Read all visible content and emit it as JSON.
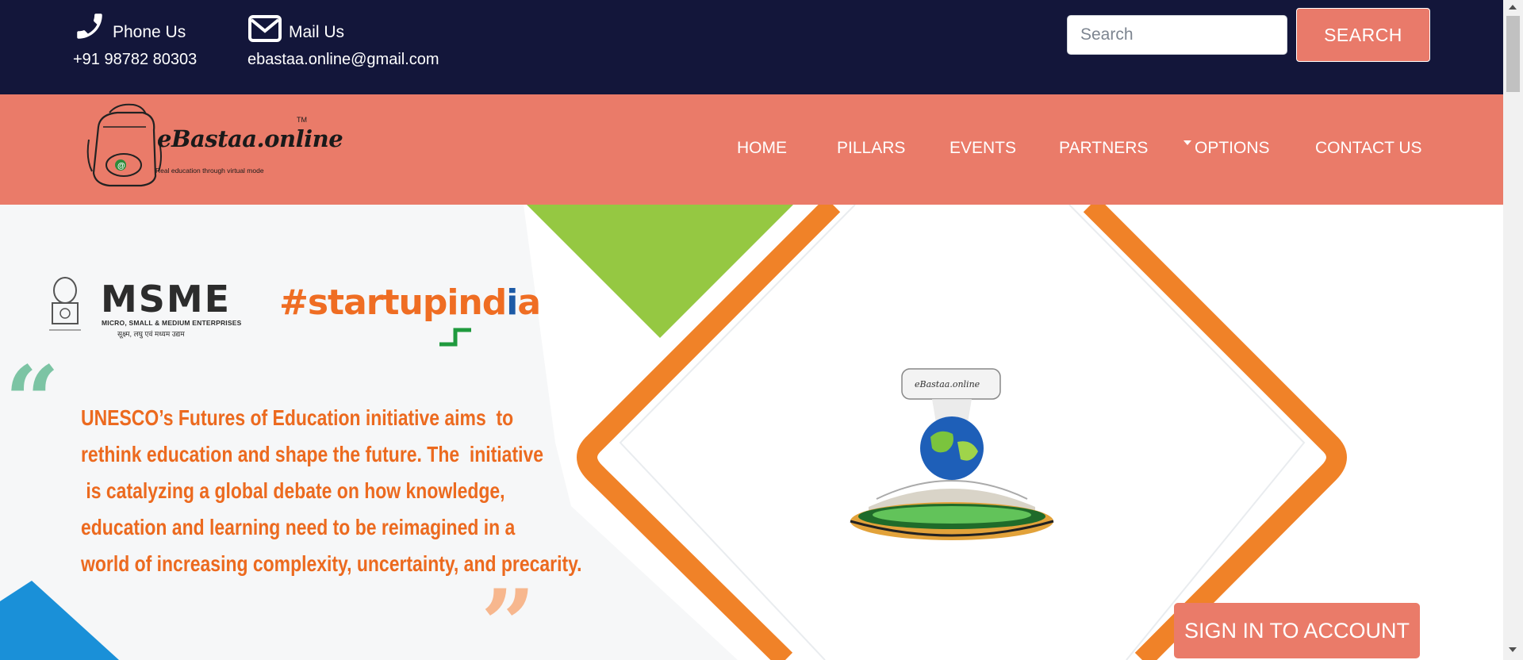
{
  "topbar": {
    "phone_label": "Phone Us",
    "phone_number": "+91 98782 80303",
    "mail_label": "Mail Us",
    "email": "ebastaa.online@gmail.com",
    "search_placeholder": "Search",
    "search_button": "SEARCH"
  },
  "logo": {
    "name": "eBastaa.online",
    "tagline": "Real education through virtual mode",
    "tm": "TM"
  },
  "nav": {
    "items": [
      "HOME",
      "PILLARS",
      "EVENTS",
      "PARTNERS",
      "OPTIONS",
      "CONTACT US"
    ]
  },
  "hero": {
    "msme_word": "MSME",
    "msme_sub": "MICRO, SMALL & MEDIUM ENTERPRISES",
    "msme_hindi": "सूक्ष्म, लघु एवं मध्यम उद्यम",
    "startup_main": "#startupind",
    "startup_i": "i",
    "startup_a": "a",
    "quote_lines": [
      "UNESCO’s Futures of Education initiative aims  to",
      "rethink education and shape the future. The  initiative",
      " is catalyzing a global debate on how knowledge,",
      "education and learning need to be reimagined in a",
      "world of increasing complexity, uncertainty, and precarity."
    ],
    "signin_button": "SIGN IN TO ACCOUNT"
  },
  "colors": {
    "topbar_bg": "#13163a",
    "nav_bg": "#ea7b69",
    "accent_orange": "#f08228",
    "accent_green": "#95c842",
    "accent_blue": "#1a90d8"
  }
}
